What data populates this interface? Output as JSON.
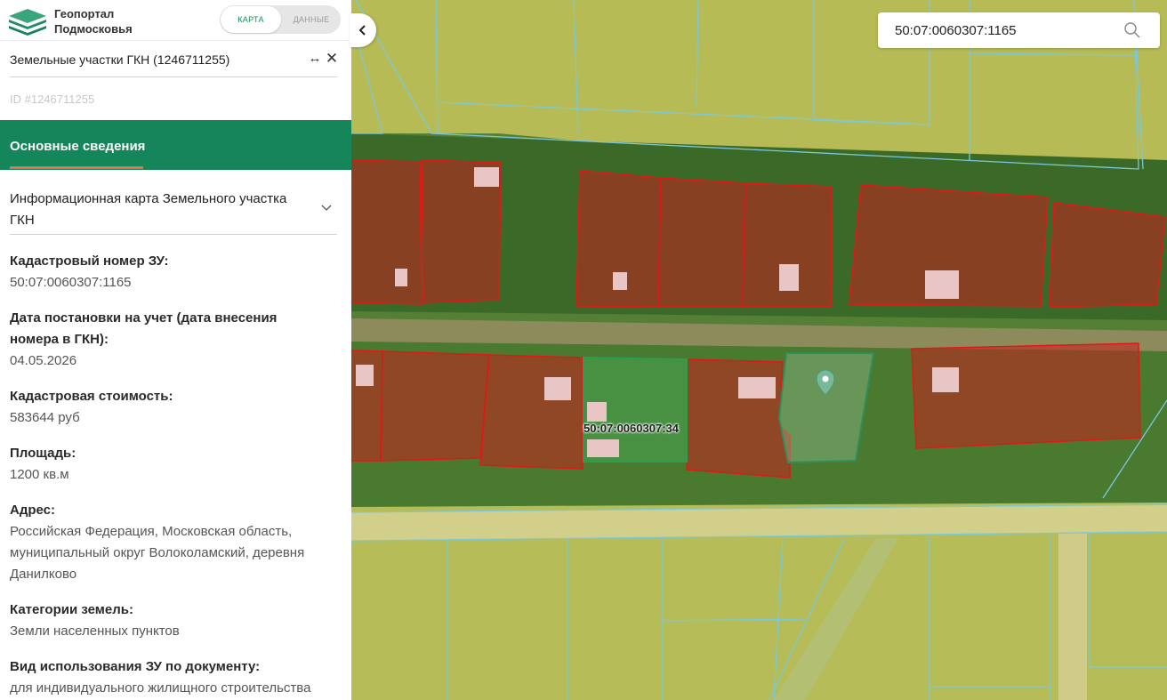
{
  "app": {
    "title_line1": "Геопортал",
    "title_line2": "Подмосковья",
    "toggle_map": "КАРТА",
    "toggle_data": "ДАННЫЕ"
  },
  "panel": {
    "layer_title": "Земельные участки ГКН (1246711255)",
    "object_id": "ID #1246711255",
    "active_tab": "Основные сведения",
    "section_title": "Информационная карта Земельного участка ГКН",
    "fields": [
      {
        "label": "Кадастровый номер ЗУ:",
        "value": "50:07:0060307:1165"
      },
      {
        "label": "Дата постановки на учет (дата внесения номера в ГКН):",
        "value": "04.05.2026"
      },
      {
        "label": "Кадастровая стоимость:",
        "value": "583644 руб"
      },
      {
        "label": "Площадь:",
        "value": "1200 кв.м"
      },
      {
        "label": "Адрес:",
        "value": "Российская Федерация, Московская область, муниципальный округ Волоколамский, деревня Данилково"
      },
      {
        "label": "Категории земель:",
        "value": "Земли населенных пунктов"
      },
      {
        "label": "Вид использования ЗУ по документу:",
        "value": "для индивидуального жилищного строительства"
      }
    ]
  },
  "map": {
    "search_value": "50:07:0060307:1165",
    "parcel_label": "50:07:0060307:34"
  },
  "colors": {
    "accent_green": "#15855a",
    "tab_underline": "#e0774b",
    "parcel_red": "#d02020",
    "parcel_selected": "#3f9b55",
    "cadastral_line": "#7cc8d8"
  },
  "icons": [
    "logo-icon",
    "expand-icon",
    "close-icon",
    "chevron-down-icon",
    "collapse-left-icon",
    "search-icon",
    "location-pin-icon"
  ]
}
